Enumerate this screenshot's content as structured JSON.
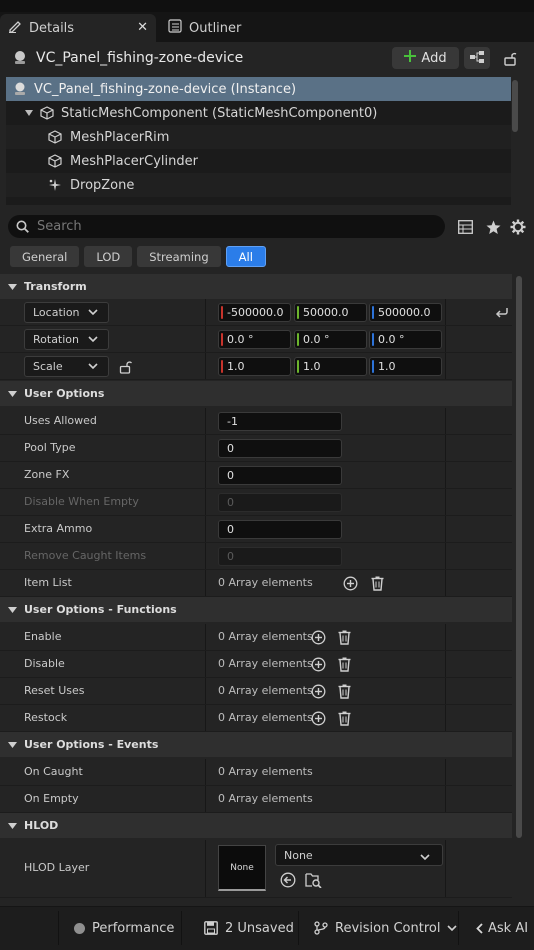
{
  "tabs": [
    {
      "label": "Details",
      "icon": "pencil-icon"
    },
    {
      "label": "Outliner",
      "icon": "outliner-icon"
    }
  ],
  "close_glyph": "✕",
  "actor": {
    "name": "VC_Panel_fishing-zone-device",
    "add_label": "Add"
  },
  "tree": [
    {
      "label": "VC_Panel_fishing-zone-device (Instance)",
      "icon": "actor-icon"
    },
    {
      "label": "StaticMeshComponent (StaticMeshComponent0)",
      "icon": "cube-icon"
    },
    {
      "label": "MeshPlacerRim",
      "icon": "cube-icon"
    },
    {
      "label": "MeshPlacerCylinder",
      "icon": "cube-icon"
    },
    {
      "label": "DropZone",
      "icon": "spark-icon"
    }
  ],
  "search": {
    "placeholder": "Search"
  },
  "filters": [
    "General",
    "LOD",
    "Streaming",
    "All"
  ],
  "transform": {
    "category": "Transform",
    "location_label": "Location",
    "rotation_label": "Rotation",
    "scale_label": "Scale",
    "location": [
      "-500000.0",
      "50000.0",
      "500000.0"
    ],
    "rotation": [
      "0.0 °",
      "0.0 °",
      "0.0 °"
    ],
    "scale": [
      "1.0",
      "1.0",
      "1.0"
    ]
  },
  "axis_colors": {
    "x": "#c8342c",
    "y": "#6cb52d",
    "z": "#2d73d9"
  },
  "user_options": {
    "category": "User Options",
    "rows": [
      {
        "label": "Uses Allowed",
        "value": "-1"
      },
      {
        "label": "Pool Type",
        "value": "0"
      },
      {
        "label": "Zone FX",
        "value": "0"
      },
      {
        "label": "Disable When Empty",
        "value": "0"
      },
      {
        "label": "Extra Ammo",
        "value": "0"
      },
      {
        "label": "Remove Caught Items",
        "value": "0"
      },
      {
        "label": "Item List",
        "value": "0 Array elements"
      }
    ]
  },
  "functions": {
    "category": "User Options - Functions",
    "rows": [
      {
        "label": "Enable",
        "value": "0 Array elements"
      },
      {
        "label": "Disable",
        "value": "0 Array elements"
      },
      {
        "label": "Reset Uses",
        "value": "0 Array elements"
      },
      {
        "label": "Restock",
        "value": "0 Array elements"
      }
    ]
  },
  "events": {
    "category": "User Options - Events",
    "rows": [
      {
        "label": "On Caught",
        "value": "0 Array elements"
      },
      {
        "label": "On Empty",
        "value": "0 Array elements"
      }
    ]
  },
  "hlod": {
    "category": "HLOD",
    "layer_label": "HLOD Layer",
    "thumb_text": "None",
    "selected": "None"
  },
  "statusbar": {
    "performance": "Performance",
    "unsaved": "2 Unsaved",
    "revision": "Revision Control",
    "ask": "Ask AI"
  }
}
